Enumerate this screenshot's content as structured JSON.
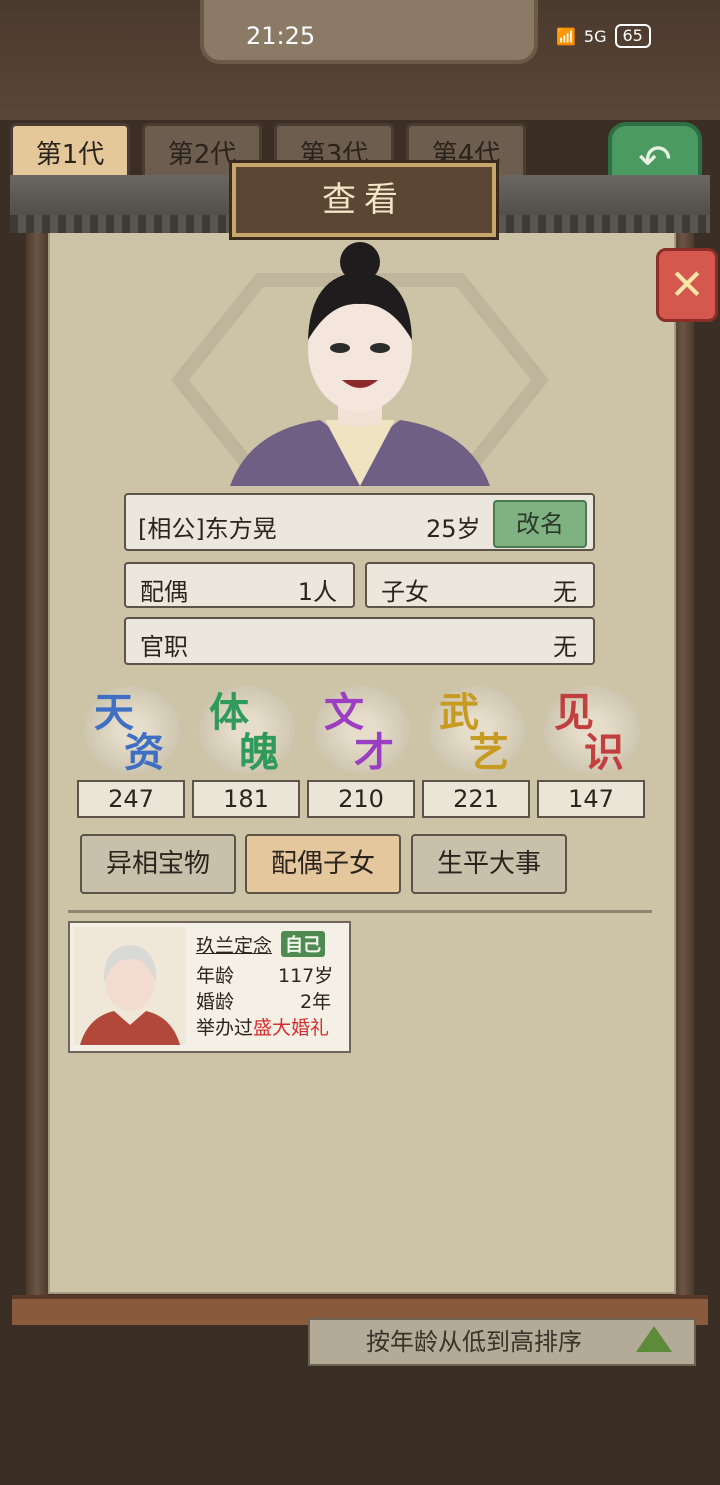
{
  "status": {
    "time": "21:25",
    "network": "5G",
    "battery": "65"
  },
  "generations": [
    "第1代",
    "第2代",
    "第3代",
    "第4代"
  ],
  "dialog": {
    "title": "查看",
    "close_icon": "x-icon"
  },
  "person": {
    "name": "[相公]东方晃",
    "age": "25岁",
    "rename_label": "改名",
    "spouse_label": "配偶",
    "spouse_value": "1人",
    "children_label": "子女",
    "children_value": "无",
    "office_label": "官职",
    "office_value": "无"
  },
  "attributes": [
    {
      "c1": "天",
      "c2": "资",
      "value": "247",
      "color": "#3f6fc2"
    },
    {
      "c1": "体",
      "c2": "魄",
      "value": "181",
      "color": "#2f9a5a"
    },
    {
      "c1": "文",
      "c2": "才",
      "value": "210",
      "color": "#9a3fc2"
    },
    {
      "c1": "武",
      "c2": "艺",
      "value": "221",
      "color": "#c79a22"
    },
    {
      "c1": "见",
      "c2": "识",
      "value": "147",
      "color": "#c23f3f"
    }
  ],
  "tabs": [
    "异相宝物",
    "配偶子女",
    "生平大事"
  ],
  "spouse_card": {
    "name": "玖兰定念",
    "tag": "自己",
    "age_label": "年龄",
    "age_value": "117岁",
    "marriage_label": "婚龄",
    "marriage_value": "2年",
    "wedding_prefix": "举办过",
    "wedding_value": "盛大婚礼"
  },
  "sort_label": "按年龄从低到高排序"
}
